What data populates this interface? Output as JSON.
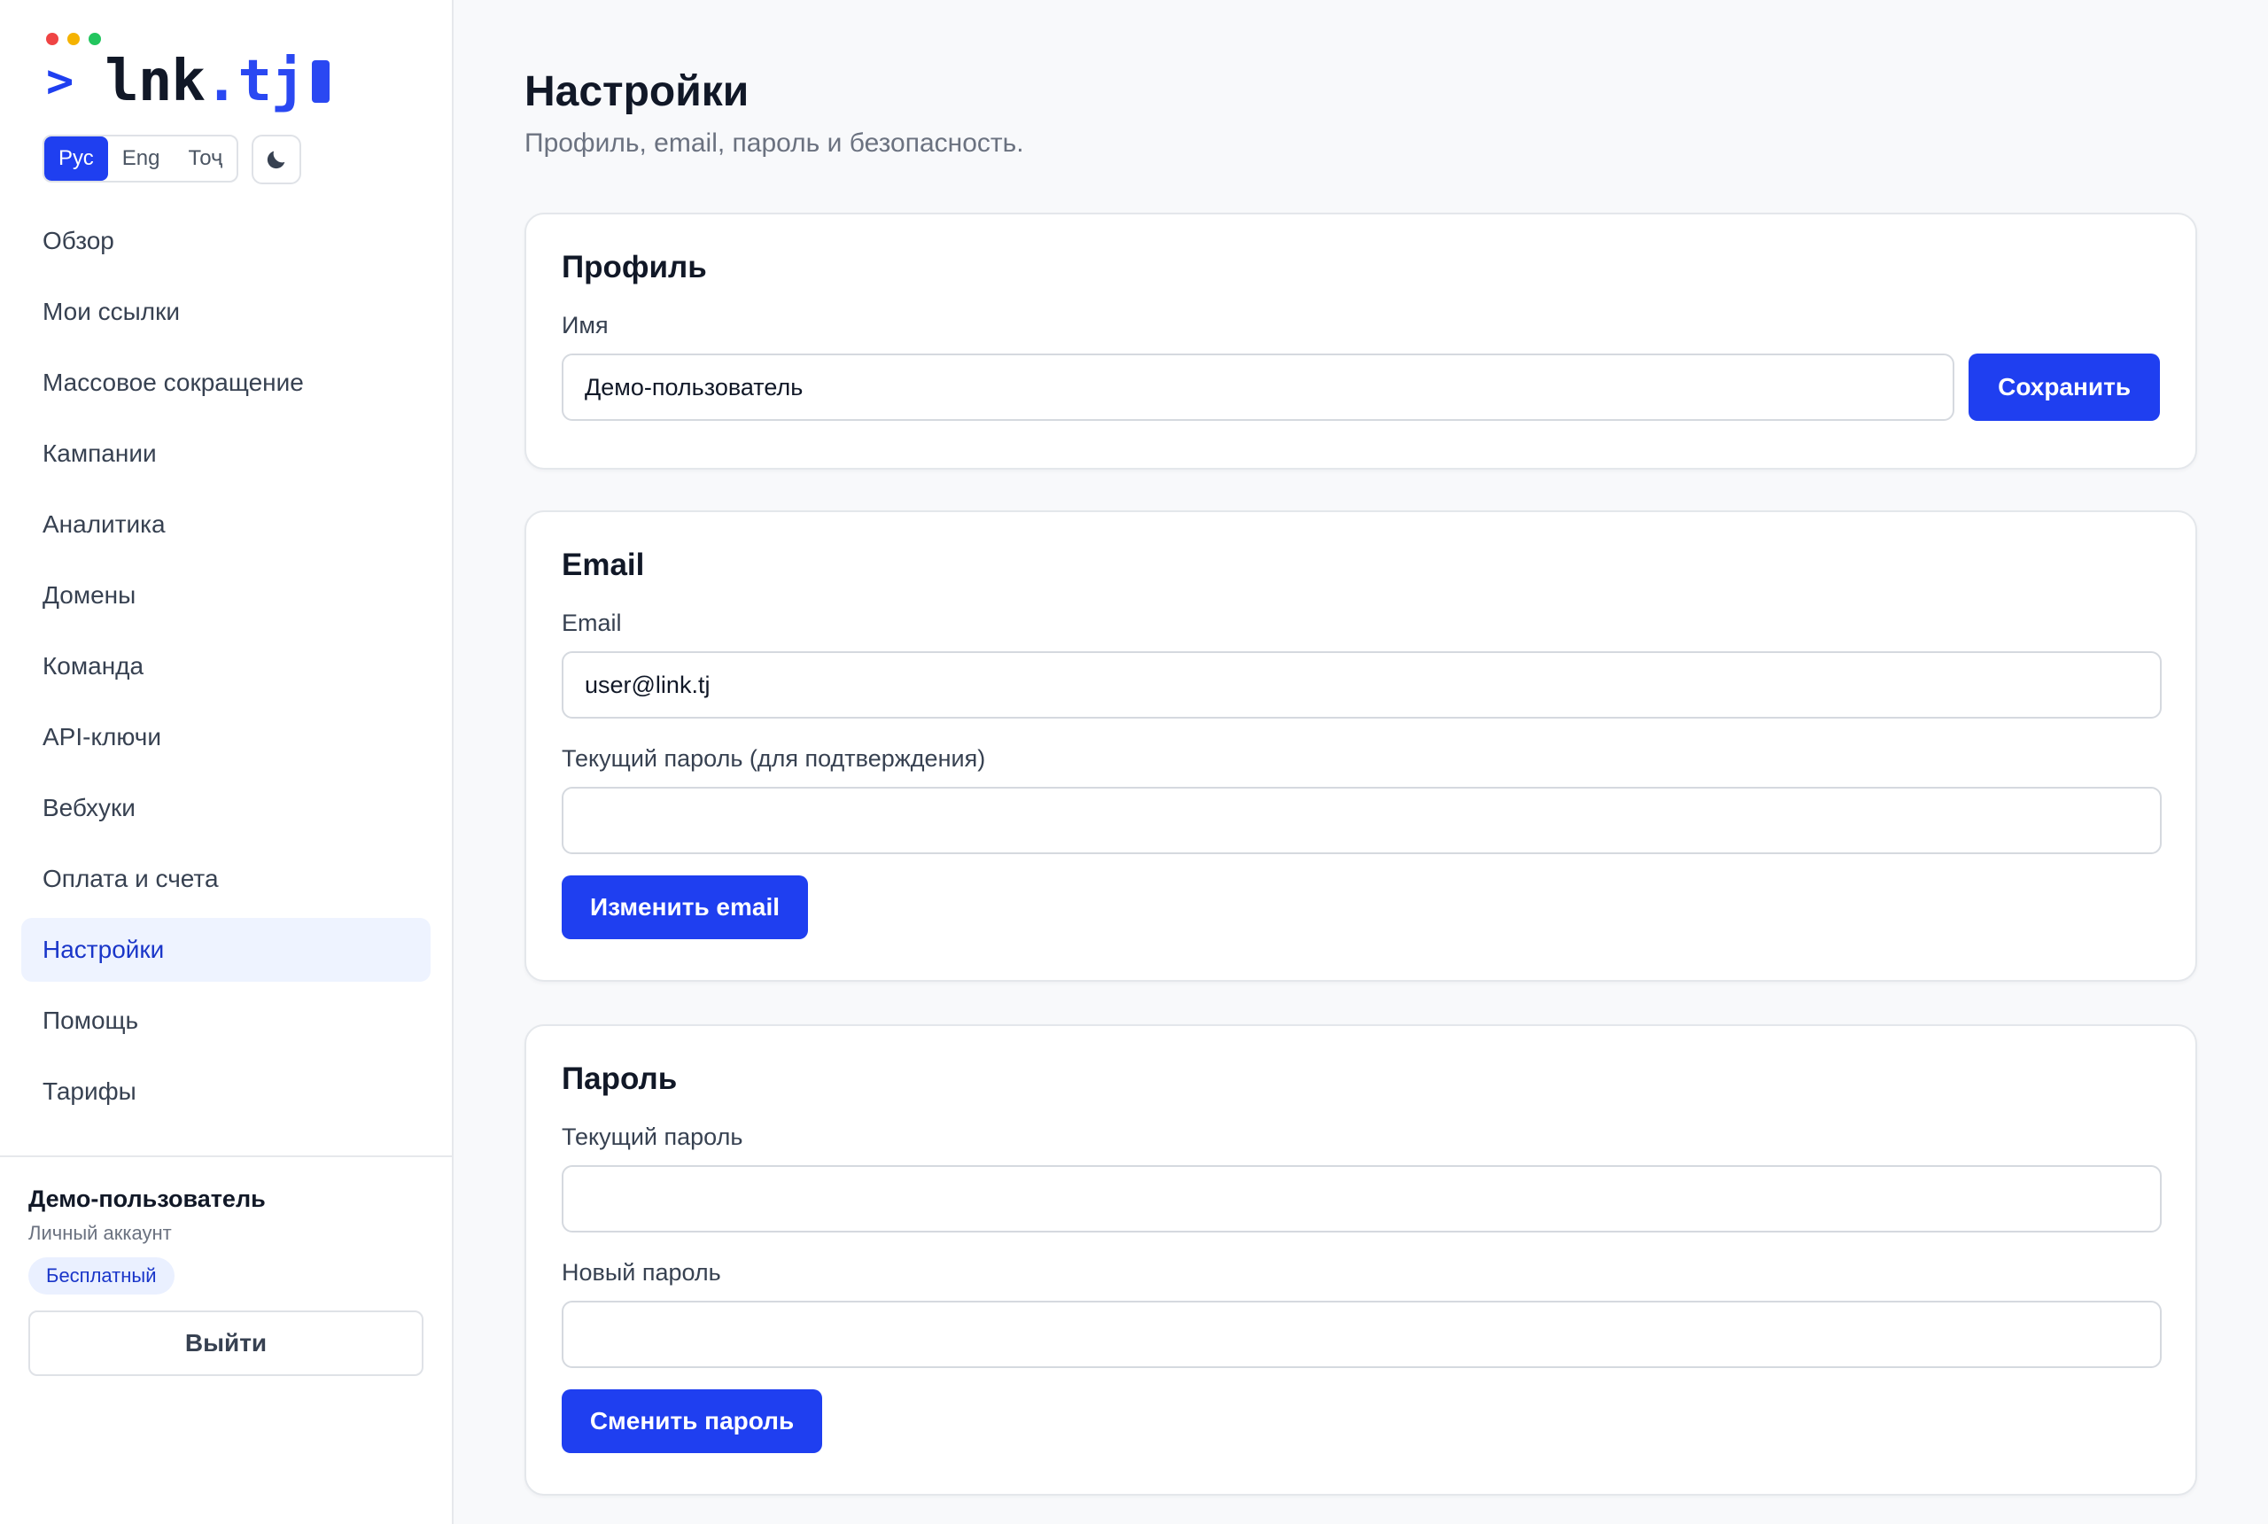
{
  "brand": {
    "prompt": ">",
    "name": "lnk",
    "tld": ".tj",
    "window_dots": [
      "#ef4444",
      "#f5b301",
      "#22c55e"
    ]
  },
  "languages": [
    {
      "label": "Рус",
      "active": true
    },
    {
      "label": "Eng",
      "active": false
    },
    {
      "label": "Тоҷ",
      "active": false
    }
  ],
  "theme_icon": "moon-icon",
  "nav": [
    {
      "label": "Обзор"
    },
    {
      "label": "Мои ссылки"
    },
    {
      "label": "Массовое сокращение"
    },
    {
      "label": "Кампании"
    },
    {
      "label": "Аналитика"
    },
    {
      "label": "Домены"
    },
    {
      "label": "Команда"
    },
    {
      "label": "API-ключи"
    },
    {
      "label": "Вебхуки"
    },
    {
      "label": "Оплата и счета"
    },
    {
      "label": "Настройки"
    },
    {
      "label": "Помощь"
    },
    {
      "label": "Тарифы"
    }
  ],
  "account": {
    "name": "Демо-пользователь",
    "type": "Личный аккаунт",
    "plan": "Бесплатный",
    "logout": "Выйти"
  },
  "page": {
    "title": "Настройки",
    "subtitle": "Профиль, email, пароль и безопасность."
  },
  "profile": {
    "title": "Профиль",
    "name_label": "Имя",
    "name_value": "Демо-пользователь",
    "save": "Сохранить"
  },
  "email": {
    "title": "Email",
    "email_label": "Email",
    "email_value": "user@link.tj",
    "password_label": "Текущий пароль (для подтверждения)",
    "password_value": "",
    "submit": "Изменить email"
  },
  "password": {
    "title": "Пароль",
    "current_label": "Текущий пароль",
    "current_value": "",
    "new_label": "Новый пароль",
    "new_value": "",
    "submit": "Сменить пароль"
  },
  "colors": {
    "accent": "#1f3ff0",
    "active_nav_bg": "#eef3ff"
  }
}
